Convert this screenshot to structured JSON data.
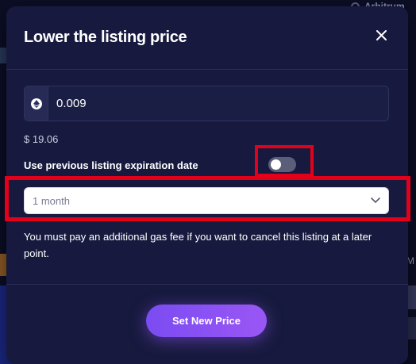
{
  "background": {
    "chain_label": "Arbitrum",
    "right_partial_letter": "M"
  },
  "modal": {
    "title": "Lower the listing price",
    "close_icon": "close-icon",
    "price": {
      "currency_icon": "ethereum-icon",
      "value": "0.009",
      "usd_value": "$ 19.06"
    },
    "expiration_toggle": {
      "label": "Use previous listing expiration date",
      "state": "off"
    },
    "duration_select": {
      "selected": "1 month",
      "icon": "chevron-down-icon"
    },
    "gas_note": "You must pay an additional gas fee if you want to cancel this listing at a later point.",
    "submit_label": "Set New Price"
  },
  "colors": {
    "modal_bg": "#171a3e",
    "accent": "#8a52f4",
    "highlight": "#e3001b"
  }
}
